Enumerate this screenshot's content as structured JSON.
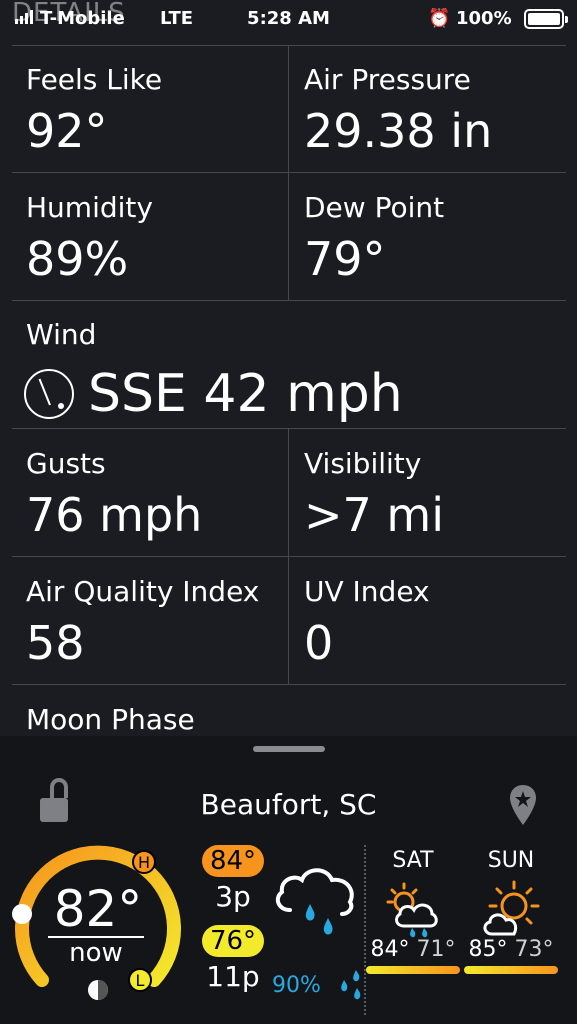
{
  "status_bar": {
    "overlay_title": "DETAILS",
    "carrier": "T-Mobile",
    "network": "LTE",
    "time": "5:28 AM",
    "battery": "100%"
  },
  "details": {
    "feels_like": {
      "label": "Feels Like",
      "value": "92°"
    },
    "air_pressure": {
      "label": "Air Pressure",
      "value": "29.38 in"
    },
    "humidity": {
      "label": "Humidity",
      "value": "89%"
    },
    "dew_point": {
      "label": "Dew Point",
      "value": "79°"
    },
    "wind": {
      "label": "Wind",
      "value": "SSE 42 mph"
    },
    "gusts": {
      "label": "Gusts",
      "value": "76 mph"
    },
    "visibility": {
      "label": "Visibility",
      "value": ">7 mi"
    },
    "aqi": {
      "label": "Air Quality Index",
      "value": "58"
    },
    "uv": {
      "label": "UV Index",
      "value": "0"
    },
    "moon_phase": {
      "label": "Moon Phase"
    }
  },
  "current": {
    "location": "Beaufort, SC",
    "temp": "82°",
    "now_label": "now",
    "hi_marker": "H",
    "lo_marker": "L",
    "high": "84°",
    "high_time": "3p",
    "low": "76°",
    "low_time": "11p",
    "precip": "90%",
    "condition_icon": "rain-cloud-icon"
  },
  "forecast": [
    {
      "day": "SAT",
      "high": "84°",
      "low": "71°",
      "icon": "partly-sunny-rain-icon"
    },
    {
      "day": "SUN",
      "high": "85°",
      "low": "73°",
      "icon": "partly-sunny-icon"
    }
  ],
  "colors": {
    "background": "#1b1c21",
    "panel": "#141519",
    "high_badge": "#f7941d",
    "low_badge": "#f3ea2c",
    "precip": "#29a8e0"
  }
}
